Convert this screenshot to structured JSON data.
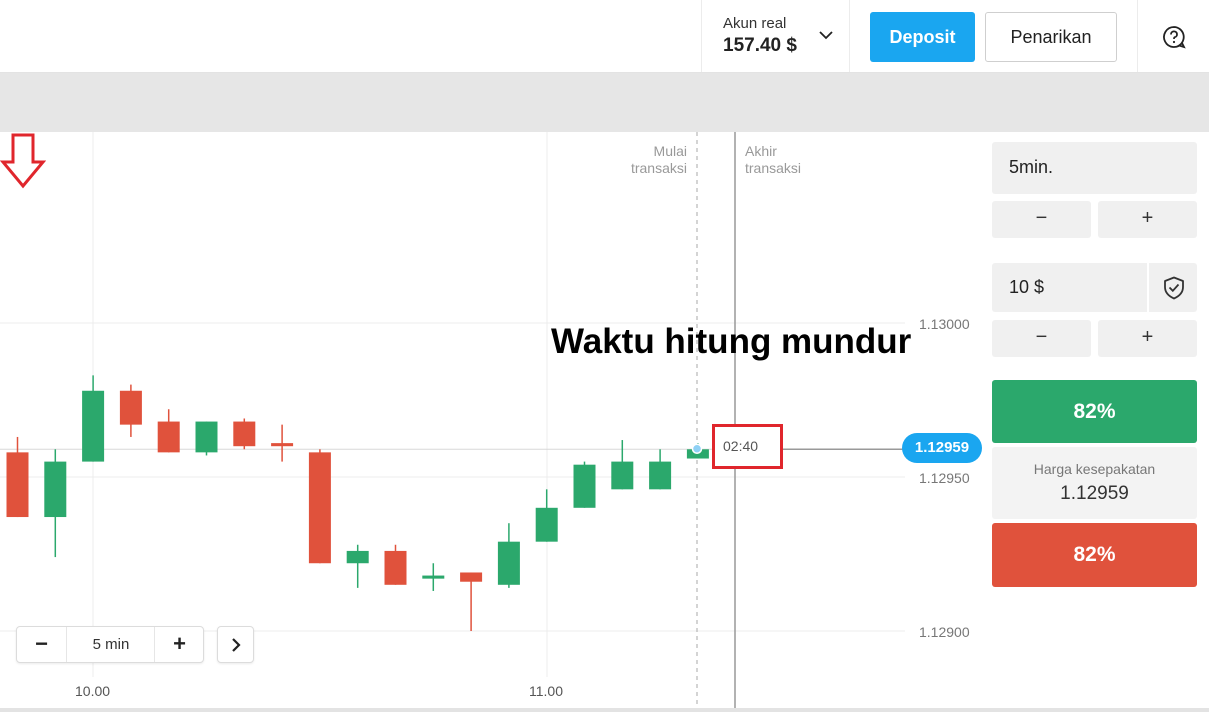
{
  "header": {
    "account_label": "Akun real",
    "balance": "157.40 $",
    "deposit_label": "Deposit",
    "withdraw_label": "Penarikan"
  },
  "chart": {
    "start_label_1": "Mulai",
    "start_label_2": "transaksi",
    "end_label_1": "Akhir",
    "end_label_2": "transaksi",
    "y_ticks": [
      "1.13000",
      "1.12950",
      "1.12900"
    ],
    "x_ticks": [
      "10.00",
      "11.00"
    ],
    "current_price": "1.12959",
    "countdown": "02:40",
    "annotation": "Waktu hitung mundur",
    "zoom_value": "5 min",
    "colors": {
      "up": "#2ba86c",
      "down": "#e0523c",
      "accent": "#1aa6f0",
      "annotation": "#e0262c"
    }
  },
  "chart_data": {
    "type": "candlestick",
    "x_ticks": [
      "10.00",
      "11.00"
    ],
    "y_ticks": [
      "1.13000",
      "1.12950",
      "1.12900"
    ],
    "ylim": [
      1.1289,
      1.1305
    ],
    "current_price": 1.12959,
    "candles": [
      {
        "open": 1.12958,
        "close": 1.12937,
        "high": 1.12963,
        "low": 1.12937
      },
      {
        "open": 1.12937,
        "close": 1.12955,
        "high": 1.12959,
        "low": 1.12924
      },
      {
        "open": 1.12955,
        "close": 1.12978,
        "high": 1.12983,
        "low": 1.12955
      },
      {
        "open": 1.12978,
        "close": 1.12967,
        "high": 1.1298,
        "low": 1.12963
      },
      {
        "open": 1.12968,
        "close": 1.12958,
        "high": 1.12972,
        "low": 1.12958
      },
      {
        "open": 1.12958,
        "close": 1.12968,
        "high": 1.12968,
        "low": 1.12957
      },
      {
        "open": 1.12968,
        "close": 1.1296,
        "high": 1.12969,
        "low": 1.12959
      },
      {
        "open": 1.12961,
        "close": 1.1296,
        "high": 1.12967,
        "low": 1.12955
      },
      {
        "open": 1.12958,
        "close": 1.12922,
        "high": 1.12959,
        "low": 1.12922
      },
      {
        "open": 1.12922,
        "close": 1.12926,
        "high": 1.12928,
        "low": 1.12914
      },
      {
        "open": 1.12926,
        "close": 1.12915,
        "high": 1.12928,
        "low": 1.12915
      },
      {
        "open": 1.12917,
        "close": 1.12918,
        "high": 1.12922,
        "low": 1.12913
      },
      {
        "open": 1.12919,
        "close": 1.12916,
        "high": 1.12919,
        "low": 1.129
      },
      {
        "open": 1.12915,
        "close": 1.12929,
        "high": 1.12935,
        "low": 1.12914
      },
      {
        "open": 1.12929,
        "close": 1.1294,
        "high": 1.12946,
        "low": 1.12929
      },
      {
        "open": 1.1294,
        "close": 1.12954,
        "high": 1.12955,
        "low": 1.1294
      },
      {
        "open": 1.12946,
        "close": 1.12955,
        "high": 1.12962,
        "low": 1.12946
      },
      {
        "open": 1.12946,
        "close": 1.12955,
        "high": 1.12959,
        "low": 1.12946
      },
      {
        "open": 1.12956,
        "close": 1.12959,
        "high": 1.12961,
        "low": 1.12956
      }
    ]
  },
  "panel": {
    "duration": "5min.",
    "amount": "10 $",
    "minus": "−",
    "plus": "+",
    "call_payout": "82%",
    "strike_label": "Harga kesepakatan",
    "strike_value": "1.12959",
    "put_payout": "82%"
  }
}
